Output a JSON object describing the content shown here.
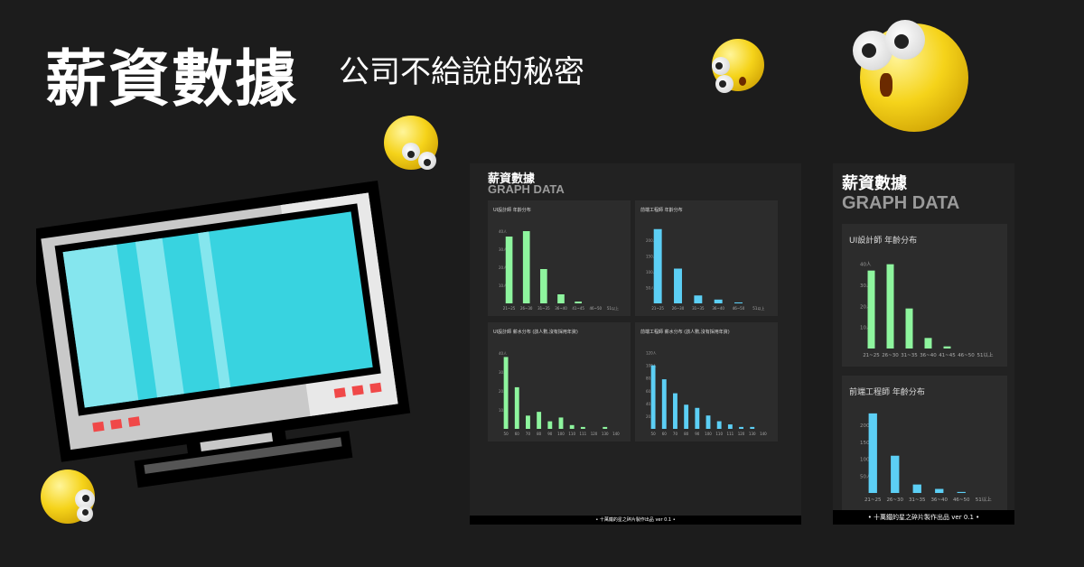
{
  "header": {
    "title": "薪資數據",
    "subtitle": "公司不給說的秘密"
  },
  "panel_desktop": {
    "title": "薪資數據",
    "subtitle": "GRAPH DATA",
    "footer": "• 十萬鐵的星之碎片製作出品 ver 0.1 •"
  },
  "panel_mobile": {
    "title": "薪資數據",
    "subtitle": "GRAPH DATA",
    "footer": "• 十萬鐵的星之碎片製作出品 ver 0.1 •"
  },
  "colors": {
    "background": "#1c1c1c",
    "panel": "#222222",
    "card": "#2c2c2c",
    "green": "#8ef59e",
    "blue": "#5ccff5",
    "screen": "#38d3e0"
  },
  "chart_data": [
    {
      "type": "bar",
      "title": "UI設計師 年齡分布",
      "categories": [
        "21~25",
        "26~30",
        "31~35",
        "36~40",
        "41~45",
        "46~50",
        "51以上"
      ],
      "values": [
        37,
        40,
        19,
        5,
        1,
        0,
        0
      ],
      "yticks": [
        "10人",
        "20人",
        "30人",
        "40人"
      ],
      "ytick_values": [
        10,
        20,
        30,
        40
      ],
      "ylim": [
        0,
        42
      ],
      "color": "#8ef59e",
      "grid": false
    },
    {
      "type": "bar",
      "title": "前端工程師 年齡分布",
      "categories": [
        "21~25",
        "26~30",
        "31~35",
        "36~40",
        "46~50",
        "51以上"
      ],
      "values": [
        235,
        110,
        25,
        12,
        3,
        0
      ],
      "yticks": [
        "50人",
        "100人",
        "150人",
        "200人"
      ],
      "ytick_values": [
        50,
        100,
        150,
        200
      ],
      "ylim": [
        0,
        240
      ],
      "color": "#5ccff5",
      "grid": false
    },
    {
      "type": "bar",
      "title": "UI設計師 薪水分布 (該人數,沒有採用年資)",
      "categories": [
        "50",
        "60",
        "70",
        "80",
        "90",
        "100",
        "110",
        "111",
        "120",
        "130",
        "140"
      ],
      "values": [
        38,
        22,
        7,
        9,
        4,
        6,
        2,
        1,
        0,
        1,
        0
      ],
      "yticks": [
        "10人",
        "20人",
        "30人",
        "40人"
      ],
      "ytick_values": [
        10,
        20,
        30,
        40
      ],
      "ylim": [
        0,
        42
      ],
      "color": "#8ef59e",
      "grid": false
    },
    {
      "type": "bar",
      "title": "前端工程師 薪水分布 (該人數,沒有採用年資)",
      "categories": [
        "50",
        "60",
        "70",
        "80",
        "90",
        "100",
        "110",
        "111",
        "120",
        "130",
        "140"
      ],
      "values": [
        100,
        78,
        56,
        38,
        33,
        21,
        12,
        7,
        3,
        3,
        0
      ],
      "yticks": [
        "20人",
        "40人",
        "60人",
        "80人",
        "100人",
        "120人"
      ],
      "ytick_values": [
        20,
        40,
        60,
        80,
        100,
        120
      ],
      "ylim": [
        0,
        125
      ],
      "color": "#5ccff5",
      "grid": false
    }
  ]
}
